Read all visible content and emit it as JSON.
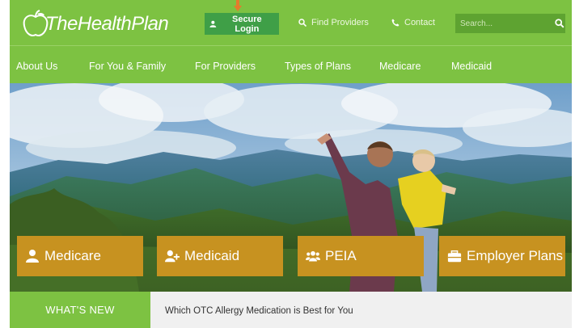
{
  "brand": {
    "logo_text": "TheHealthPlan"
  },
  "header": {
    "login_label": "Secure Login",
    "find_providers_label": "Find Providers",
    "contact_label": "Contact",
    "search_placeholder": "Search...",
    "accent_color": "#7dc242",
    "login_color": "#3f9f47"
  },
  "nav": {
    "items": [
      {
        "label": "About Us"
      },
      {
        "label": "For You & Family"
      },
      {
        "label": "For Providers"
      },
      {
        "label": "Types of Plans"
      },
      {
        "label": "Medicare"
      },
      {
        "label": "Medicaid"
      }
    ]
  },
  "tiles": [
    {
      "label": "Medicare",
      "icon": "user-icon"
    },
    {
      "label": "Medicaid",
      "icon": "user-plus-icon"
    },
    {
      "label": "PEIA",
      "icon": "users-icon"
    },
    {
      "label": "Employer Plans",
      "icon": "briefcase-icon"
    }
  ],
  "tile_color": "#c79220",
  "news": {
    "label": "WHAT'S NEW",
    "headline": "Which OTC Allergy Medication is Best for You"
  }
}
